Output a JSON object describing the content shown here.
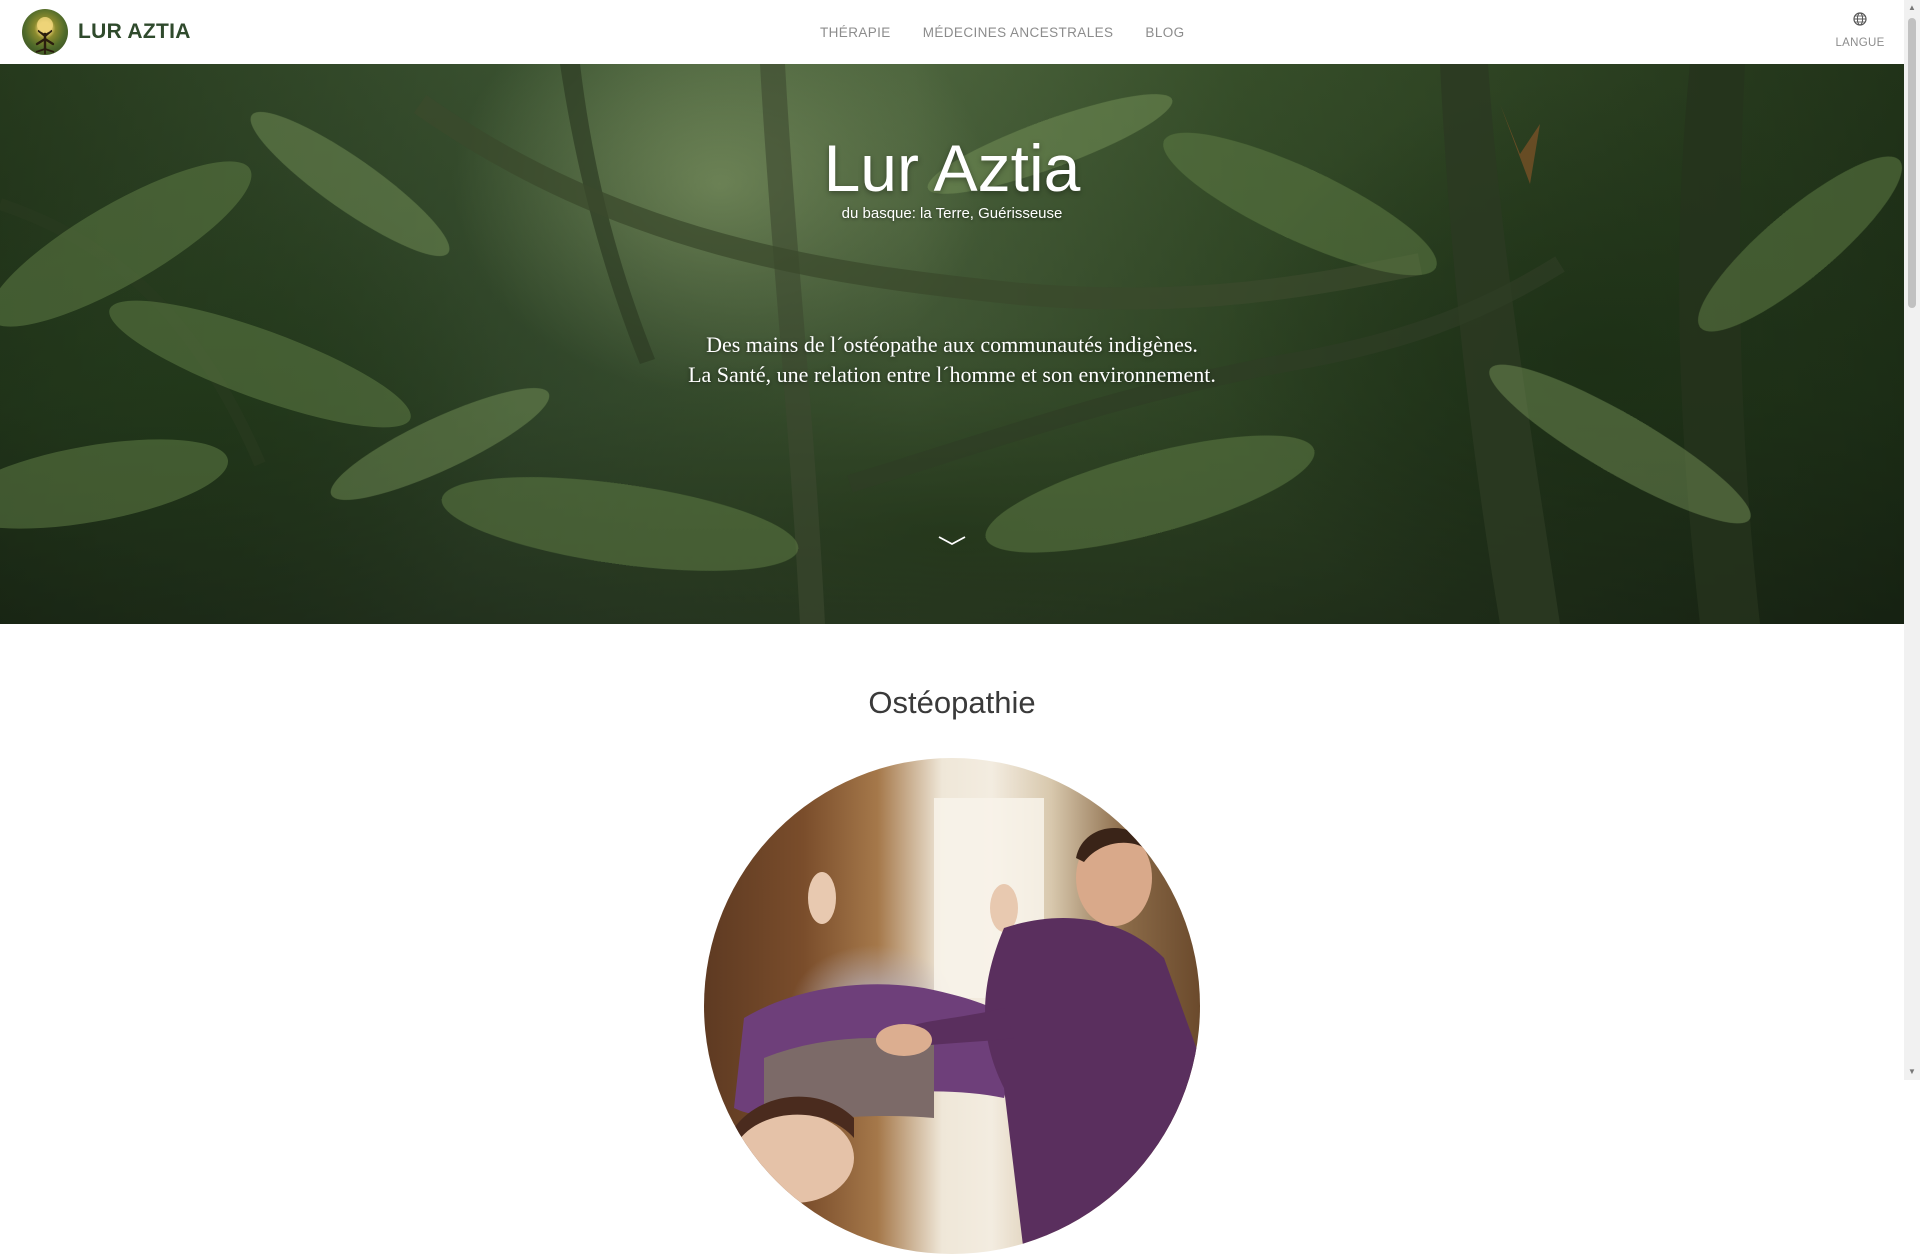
{
  "navbar": {
    "brand": "LUR AZTIA",
    "logo_icon": "tree-of-life-logo",
    "links": [
      "THÉRAPIE",
      "MÉDECINES ANCESTRALES",
      "BLOG"
    ],
    "language_label": "LANGUE",
    "language_icon": "globe-icon"
  },
  "hero": {
    "title": "Lur Aztia",
    "subtitle": "du basque: la Terre, Guérisseuse",
    "tagline_line1": "Des mains de l´ostéopathe aux communautés indigènes.",
    "tagline_line2": "La Santé, une relation entre l´homme et son environnement.",
    "scroll_icon": "chevron-down-icon"
  },
  "section": {
    "title": "Ostéopathie",
    "image": "osteopathy-treatment-photo"
  },
  "colors": {
    "brand_text": "#2f4a2c",
    "nav_text": "#8c8c8c",
    "hero_text": "#ffffff",
    "section_title": "#3a3a3a"
  }
}
